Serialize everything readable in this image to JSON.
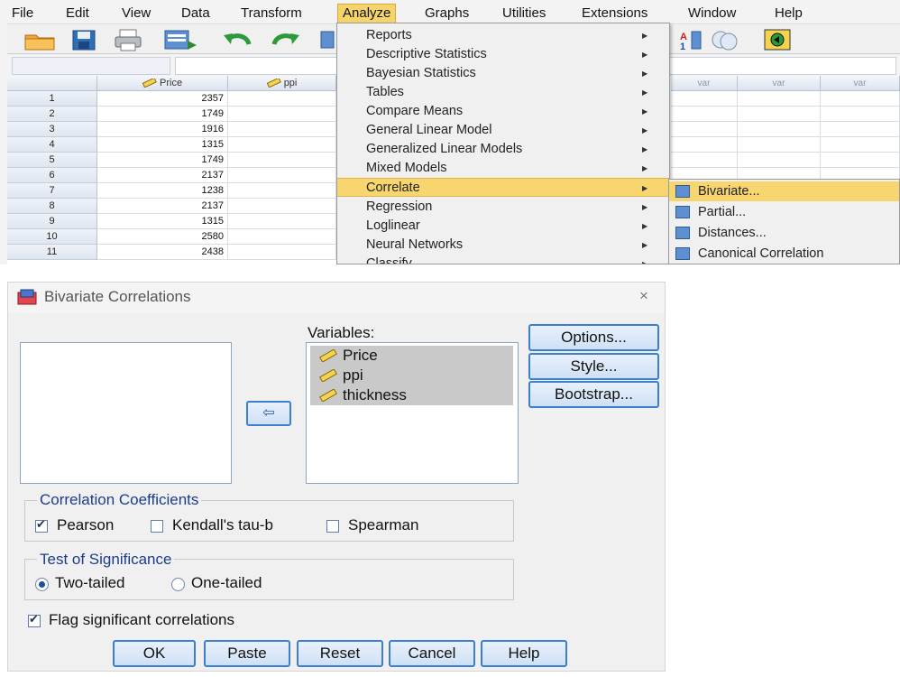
{
  "menubar": {
    "items": [
      "File",
      "Edit",
      "View",
      "Data",
      "Transform",
      "Analyze",
      "Graphs",
      "Utilities",
      "Extensions",
      "Window",
      "Help"
    ],
    "active": "Analyze"
  },
  "grid": {
    "columns": [
      "Price",
      "ppi"
    ],
    "extra_columns": [
      "var",
      "var",
      "var"
    ],
    "rows": [
      {
        "n": "1",
        "price": "2357"
      },
      {
        "n": "2",
        "price": "1749"
      },
      {
        "n": "3",
        "price": "1916"
      },
      {
        "n": "4",
        "price": "1315"
      },
      {
        "n": "5",
        "price": "1749"
      },
      {
        "n": "6",
        "price": "2137"
      },
      {
        "n": "7",
        "price": "1238"
      },
      {
        "n": "8",
        "price": "2137"
      },
      {
        "n": "9",
        "price": "1315"
      },
      {
        "n": "10",
        "price": "2580"
      },
      {
        "n": "11",
        "price": "2438"
      }
    ]
  },
  "analyze_menu": {
    "items": [
      "Reports",
      "Descriptive Statistics",
      "Bayesian Statistics",
      "Tables",
      "Compare Means",
      "General Linear Model",
      "Generalized Linear Models",
      "Mixed Models",
      "Correlate",
      "Regression",
      "Loglinear",
      "Neural Networks",
      "Classify"
    ],
    "selected": "Correlate"
  },
  "correlate_menu": {
    "items": [
      "Bivariate...",
      "Partial...",
      "Distances...",
      "Canonical Correlation"
    ],
    "selected": "Bivariate..."
  },
  "dialog": {
    "title": "Bivariate Correlations",
    "close_glyph": "×",
    "variables_label": "Variables:",
    "variables": [
      "Price",
      "ppi",
      "thickness"
    ],
    "move_glyph": "⇦",
    "buttons": {
      "options": "Options...",
      "style": "Style...",
      "bootstrap": "Bootstrap..."
    },
    "coef_group": {
      "label": "Correlation Coefficients",
      "pearson": {
        "label": "Pearson",
        "checked": true
      },
      "kendall": {
        "label": "Kendall's tau-b",
        "checked": false
      },
      "spearman": {
        "label": "Spearman",
        "checked": false
      }
    },
    "sig_group": {
      "label": "Test of Significance",
      "two_tailed": {
        "label": "Two-tailed",
        "selected": true
      },
      "one_tailed": {
        "label": "One-tailed",
        "selected": false
      }
    },
    "flag": {
      "label": "Flag significant correlations",
      "checked": true
    },
    "footer": {
      "ok": "OK",
      "paste": "Paste",
      "reset": "Reset",
      "cancel": "Cancel",
      "help": "Help"
    }
  },
  "colors": {
    "accent": "#3c7fd1",
    "highlight": "#f7d66f",
    "group_text": "#1c3c8c"
  }
}
